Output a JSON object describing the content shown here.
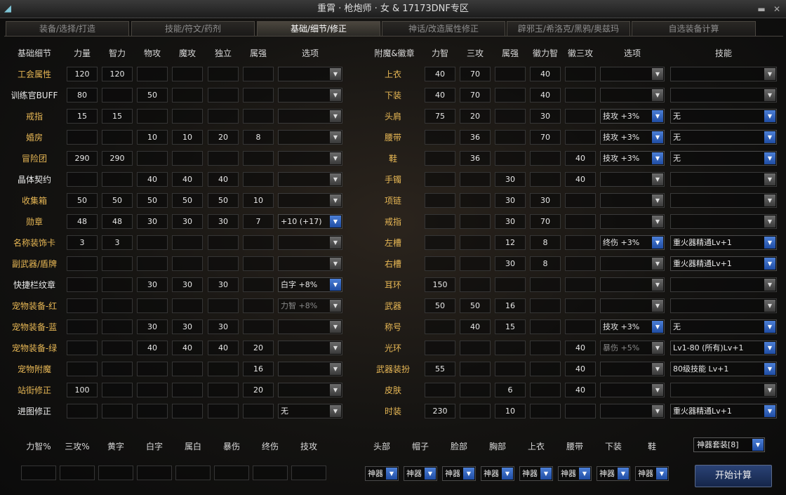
{
  "window": {
    "title": "重霄 · 枪炮师 · 女 & 17173DNF专区"
  },
  "tabs": [
    "装备/选择/打造",
    "技能/符文/药剂",
    "基础/细节/修正",
    "神话/改造属性修正",
    "辟邪玉/希洛克/黑鸦/奥兹玛",
    "自选装备计算"
  ],
  "active_tab": 2,
  "left_table": {
    "headers": [
      "基础细节",
      "力量",
      "智力",
      "物攻",
      "魔攻",
      "独立",
      "属强",
      "选项"
    ],
    "rows": [
      {
        "label": "工会属性",
        "tone": "gold",
        "values": [
          "120",
          "120",
          "",
          "",
          "",
          ""
        ],
        "option": "",
        "opt_active": false,
        "opt_dim": false
      },
      {
        "label": "训练官BUFF",
        "tone": "white",
        "values": [
          "80",
          "",
          "50",
          "",
          "",
          ""
        ],
        "option": "",
        "opt_active": false,
        "opt_dim": false
      },
      {
        "label": "戒指",
        "tone": "gold",
        "values": [
          "15",
          "15",
          "",
          "",
          "",
          ""
        ],
        "option": "",
        "opt_active": false,
        "opt_dim": false
      },
      {
        "label": "婚房",
        "tone": "gold",
        "values": [
          "",
          "",
          "10",
          "10",
          "20",
          "8"
        ],
        "option": "",
        "opt_active": false,
        "opt_dim": false
      },
      {
        "label": "冒险团",
        "tone": "gold",
        "values": [
          "290",
          "290",
          "",
          "",
          "",
          ""
        ],
        "option": "",
        "opt_active": false,
        "opt_dim": false
      },
      {
        "label": "晶体契约",
        "tone": "white",
        "values": [
          "",
          "",
          "40",
          "40",
          "40",
          ""
        ],
        "option": "",
        "opt_active": false,
        "opt_dim": false
      },
      {
        "label": "收集箱",
        "tone": "gold",
        "values": [
          "50",
          "50",
          "50",
          "50",
          "50",
          "10"
        ],
        "option": "",
        "opt_active": false,
        "opt_dim": false
      },
      {
        "label": "勋章",
        "tone": "gold",
        "values": [
          "48",
          "48",
          "30",
          "30",
          "30",
          "7"
        ],
        "option": "+10 (+17)",
        "opt_active": true,
        "opt_dim": false
      },
      {
        "label": "名称装饰卡",
        "tone": "gold",
        "values": [
          "3",
          "3",
          "",
          "",
          "",
          ""
        ],
        "option": "",
        "opt_active": false,
        "opt_dim": false
      },
      {
        "label": "副武器/盾牌",
        "tone": "gold",
        "values": [
          "",
          "",
          "",
          "",
          "",
          ""
        ],
        "option": "",
        "opt_active": false,
        "opt_dim": false
      },
      {
        "label": "快捷栏纹章",
        "tone": "white",
        "values": [
          "",
          "",
          "30",
          "30",
          "30",
          ""
        ],
        "option": "白字 +8%",
        "opt_active": true,
        "opt_dim": false
      },
      {
        "label": "宠物装备-红",
        "tone": "gold",
        "values": [
          "",
          "",
          "",
          "",
          "",
          ""
        ],
        "option": "力智 +8%",
        "opt_active": false,
        "opt_dim": true
      },
      {
        "label": "宠物装备-蓝",
        "tone": "gold",
        "values": [
          "",
          "",
          "30",
          "30",
          "30",
          ""
        ],
        "option": "",
        "opt_active": false,
        "opt_dim": false
      },
      {
        "label": "宠物装备-绿",
        "tone": "gold",
        "values": [
          "",
          "",
          "40",
          "40",
          "40",
          "20"
        ],
        "option": "",
        "opt_active": false,
        "opt_dim": false
      },
      {
        "label": "宠物附魔",
        "tone": "gold",
        "values": [
          "",
          "",
          "",
          "",
          "",
          "16"
        ],
        "option": "",
        "opt_active": false,
        "opt_dim": false
      },
      {
        "label": "站街修正",
        "tone": "gold",
        "values": [
          "100",
          "",
          "",
          "",
          "",
          "20"
        ],
        "option": "",
        "opt_active": false,
        "opt_dim": false
      },
      {
        "label": "进图修正",
        "tone": "white",
        "values": [
          "",
          "",
          "",
          "",
          "",
          ""
        ],
        "option": "无",
        "opt_active": false,
        "opt_dim": false
      }
    ]
  },
  "right_table": {
    "headers": [
      "附魔&徽章",
      "力智",
      "三攻",
      "属强",
      "徽力智",
      "徽三攻",
      "选项",
      "技能"
    ],
    "rows": [
      {
        "label": "上衣",
        "values": [
          "40",
          "70",
          "",
          "40",
          ""
        ],
        "option": "",
        "opt_active": false,
        "opt_dim": false,
        "skill": "",
        "skill_active": false
      },
      {
        "label": "下装",
        "values": [
          "40",
          "70",
          "",
          "40",
          ""
        ],
        "option": "",
        "opt_active": false,
        "opt_dim": false,
        "skill": "",
        "skill_active": false
      },
      {
        "label": "头肩",
        "values": [
          "75",
          "20",
          "",
          "30",
          ""
        ],
        "option": "技攻 +3%",
        "opt_active": true,
        "opt_dim": false,
        "skill": "无",
        "skill_active": true
      },
      {
        "label": "腰带",
        "values": [
          "",
          "36",
          "",
          "70",
          ""
        ],
        "option": "技攻 +3%",
        "opt_active": true,
        "opt_dim": false,
        "skill": "无",
        "skill_active": true
      },
      {
        "label": "鞋",
        "values": [
          "",
          "36",
          "",
          "",
          "40"
        ],
        "option": "技攻 +3%",
        "opt_active": true,
        "opt_dim": false,
        "skill": "无",
        "skill_active": true
      },
      {
        "label": "手镯",
        "values": [
          "",
          "",
          "30",
          "",
          "40"
        ],
        "option": "",
        "opt_active": false,
        "opt_dim": false,
        "skill": "",
        "skill_active": false
      },
      {
        "label": "项链",
        "values": [
          "",
          "",
          "30",
          "30",
          ""
        ],
        "option": "",
        "opt_active": false,
        "opt_dim": false,
        "skill": "",
        "skill_active": false
      },
      {
        "label": "戒指",
        "values": [
          "",
          "",
          "30",
          "70",
          ""
        ],
        "option": "",
        "opt_active": false,
        "opt_dim": false,
        "skill": "",
        "skill_active": false
      },
      {
        "label": "左槽",
        "values": [
          "",
          "",
          "12",
          "8",
          ""
        ],
        "option": "终伤 +3%",
        "opt_active": true,
        "opt_dim": false,
        "skill": "重火器精通Lv+1",
        "skill_active": true
      },
      {
        "label": "右槽",
        "values": [
          "",
          "",
          "30",
          "8",
          ""
        ],
        "option": "",
        "opt_active": false,
        "opt_dim": false,
        "skill": "重火器精通Lv+1",
        "skill_active": true
      },
      {
        "label": "耳环",
        "values": [
          "150",
          "",
          "",
          "",
          ""
        ],
        "option": "",
        "opt_active": false,
        "opt_dim": false,
        "skill": "",
        "skill_active": false
      },
      {
        "label": "武器",
        "values": [
          "50",
          "50",
          "16",
          "",
          ""
        ],
        "option": "",
        "opt_active": false,
        "opt_dim": false,
        "skill": "",
        "skill_active": false
      },
      {
        "label": "称号",
        "values": [
          "",
          "40",
          "15",
          "",
          ""
        ],
        "option": "技攻 +3%",
        "opt_active": true,
        "opt_dim": false,
        "skill": "无",
        "skill_active": true
      },
      {
        "label": "光环",
        "values": [
          "",
          "",
          "",
          "",
          "40"
        ],
        "option": "暴伤 +5%",
        "opt_active": false,
        "opt_dim": true,
        "skill": "Lv1-80 (所有)Lv+1",
        "skill_active": true
      },
      {
        "label": "武器装扮",
        "values": [
          "55",
          "",
          "",
          "",
          "40"
        ],
        "option": "",
        "opt_active": false,
        "opt_dim": false,
        "skill": "80级技能 Lv+1",
        "skill_active": true
      },
      {
        "label": "皮肤",
        "values": [
          "",
          "",
          "6",
          "",
          "40"
        ],
        "option": "",
        "opt_active": false,
        "opt_dim": false,
        "skill": "",
        "skill_active": false
      },
      {
        "label": "时装",
        "values": [
          "230",
          "",
          "10",
          "",
          ""
        ],
        "option": "",
        "opt_active": false,
        "opt_dim": false,
        "skill": "重火器精通Lv+1",
        "skill_active": true
      }
    ]
  },
  "bottom_left": {
    "headers": [
      "力智%",
      "三攻%",
      "黄字",
      "白字",
      "属白",
      "暴伤",
      "终伤",
      "技攻"
    ],
    "values": [
      "",
      "",
      "",
      "",
      "",
      "",
      "",
      ""
    ]
  },
  "bottom_right": {
    "headers": [
      "头部",
      "帽子",
      "脸部",
      "胸部",
      "上衣",
      "腰带",
      "下装",
      "鞋"
    ],
    "values": [
      "神器",
      "神器",
      "神器",
      "神器",
      "神器",
      "神器",
      "神器",
      "神器"
    ]
  },
  "god_set": "神器套装[8]",
  "calc_button": "开始计算"
}
